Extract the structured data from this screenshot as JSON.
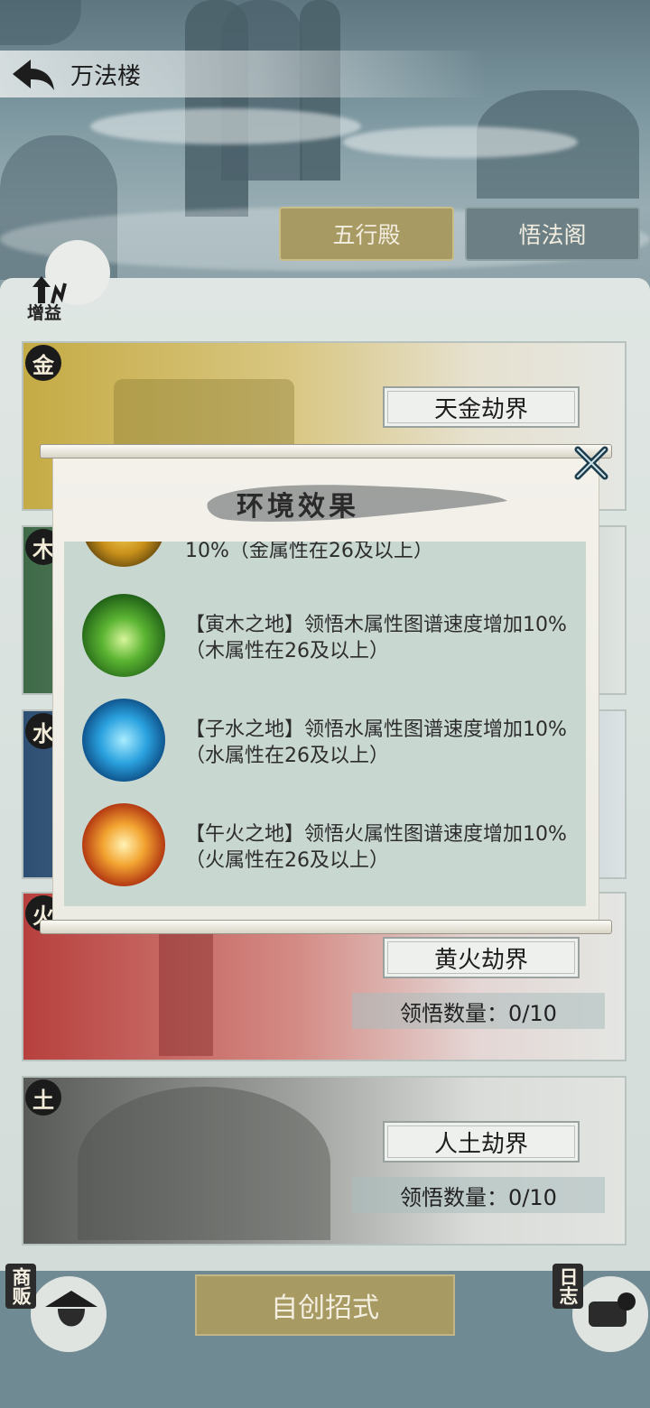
{
  "header": {
    "title": "万法楼"
  },
  "tabs": [
    {
      "label": "五行殿"
    },
    {
      "label": "悟法阁"
    }
  ],
  "boost": {
    "label": "增益"
  },
  "realms": [
    {
      "element": "金",
      "name": "天金劫界",
      "count": ""
    },
    {
      "element": "木",
      "name": "",
      "count": ""
    },
    {
      "element": "水",
      "name": "",
      "count": ""
    },
    {
      "element": "火",
      "name": "黄火劫界",
      "count": "领悟数量：0/10"
    },
    {
      "element": "土",
      "name": "人土劫界",
      "count": "领悟数量：0/10"
    }
  ],
  "bottom": {
    "create_label": "自创招式",
    "shop_label": "商贩",
    "log_label": "日志"
  },
  "modal": {
    "title": "环境效果",
    "effects": [
      {
        "text": "10%（金属性在26及以上）",
        "icon": "gold-element-icon",
        "color": "#d8a823"
      },
      {
        "text": "【寅木之地】领悟木属性图谱速度增加10%（木属性在26及以上）",
        "icon": "wood-element-icon",
        "color": "#4fa832"
      },
      {
        "text": "【子水之地】领悟水属性图谱速度增加10%（水属性在26及以上）",
        "icon": "water-element-icon",
        "color": "#2f8fd0"
      },
      {
        "text": "【午火之地】领悟火属性图谱速度增加10%（火属性在26及以上）",
        "icon": "fire-element-icon",
        "color": "#e07a1c"
      }
    ]
  }
}
